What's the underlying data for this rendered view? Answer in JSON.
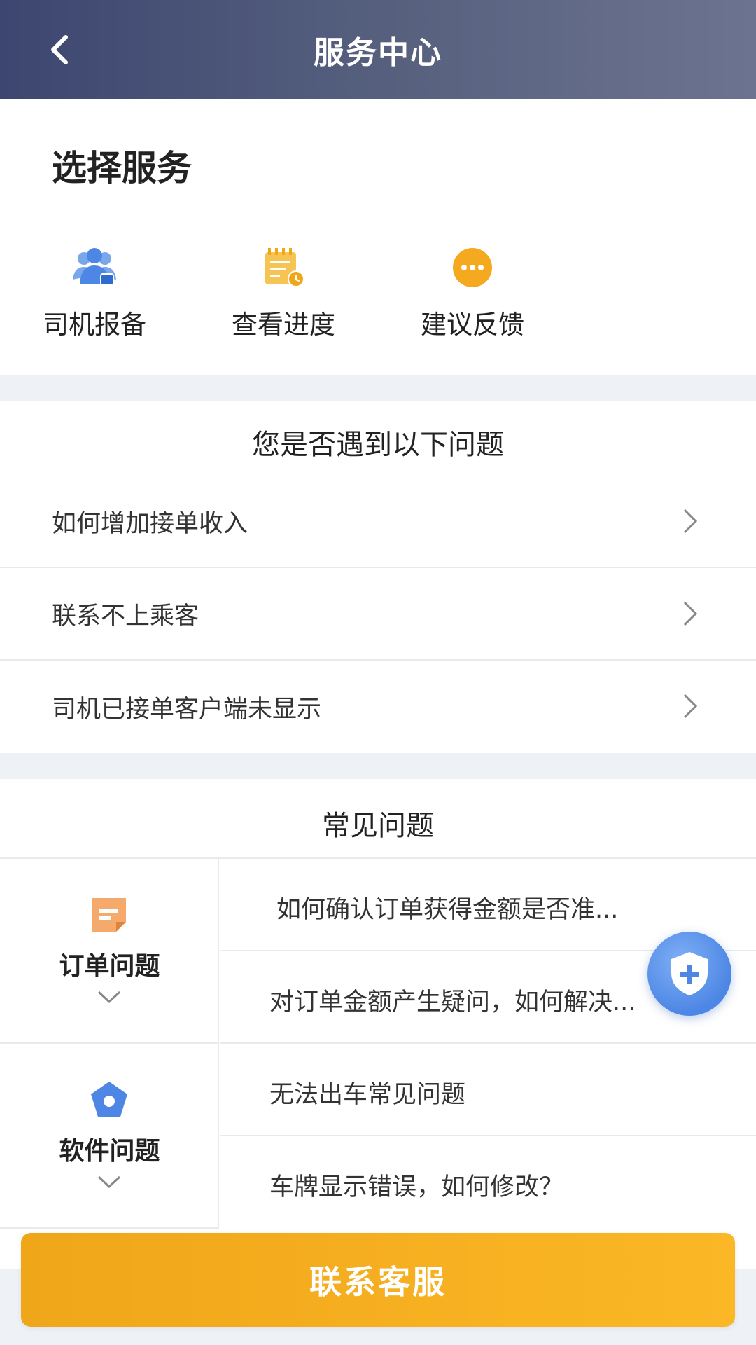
{
  "header": {
    "title": "服务中心",
    "back_icon": "chevron-left-icon"
  },
  "services": {
    "heading": "选择服务",
    "items": [
      {
        "label": "司机报备",
        "icon": "driver-report-icon"
      },
      {
        "label": "查看进度",
        "icon": "progress-note-icon"
      },
      {
        "label": "建议反馈",
        "icon": "chat-bubble-icon"
      }
    ]
  },
  "issues": {
    "title": "您是否遇到以下问题",
    "items": [
      {
        "label": "如何增加接单收入"
      },
      {
        "label": "联系不上乘客"
      },
      {
        "label": "司机已接单客户端未显示"
      }
    ]
  },
  "faq": {
    "title": "常见问题",
    "categories": [
      {
        "label": "订单问题",
        "icon": "order-doc-icon",
        "items": [
          "如何确认订单获得金额是否准...",
          "对订单金额产生疑问，如何解决..."
        ]
      },
      {
        "label": "软件问题",
        "icon": "software-pentagon-icon",
        "items": [
          "无法出车常见问题",
          "车牌显示错误，如何修改？"
        ]
      }
    ]
  },
  "contact_button": {
    "label": "联系客服"
  },
  "colors": {
    "accent": "#F5A91E",
    "header_bg": "#4A5378",
    "icon_blue": "#4D86E4"
  }
}
